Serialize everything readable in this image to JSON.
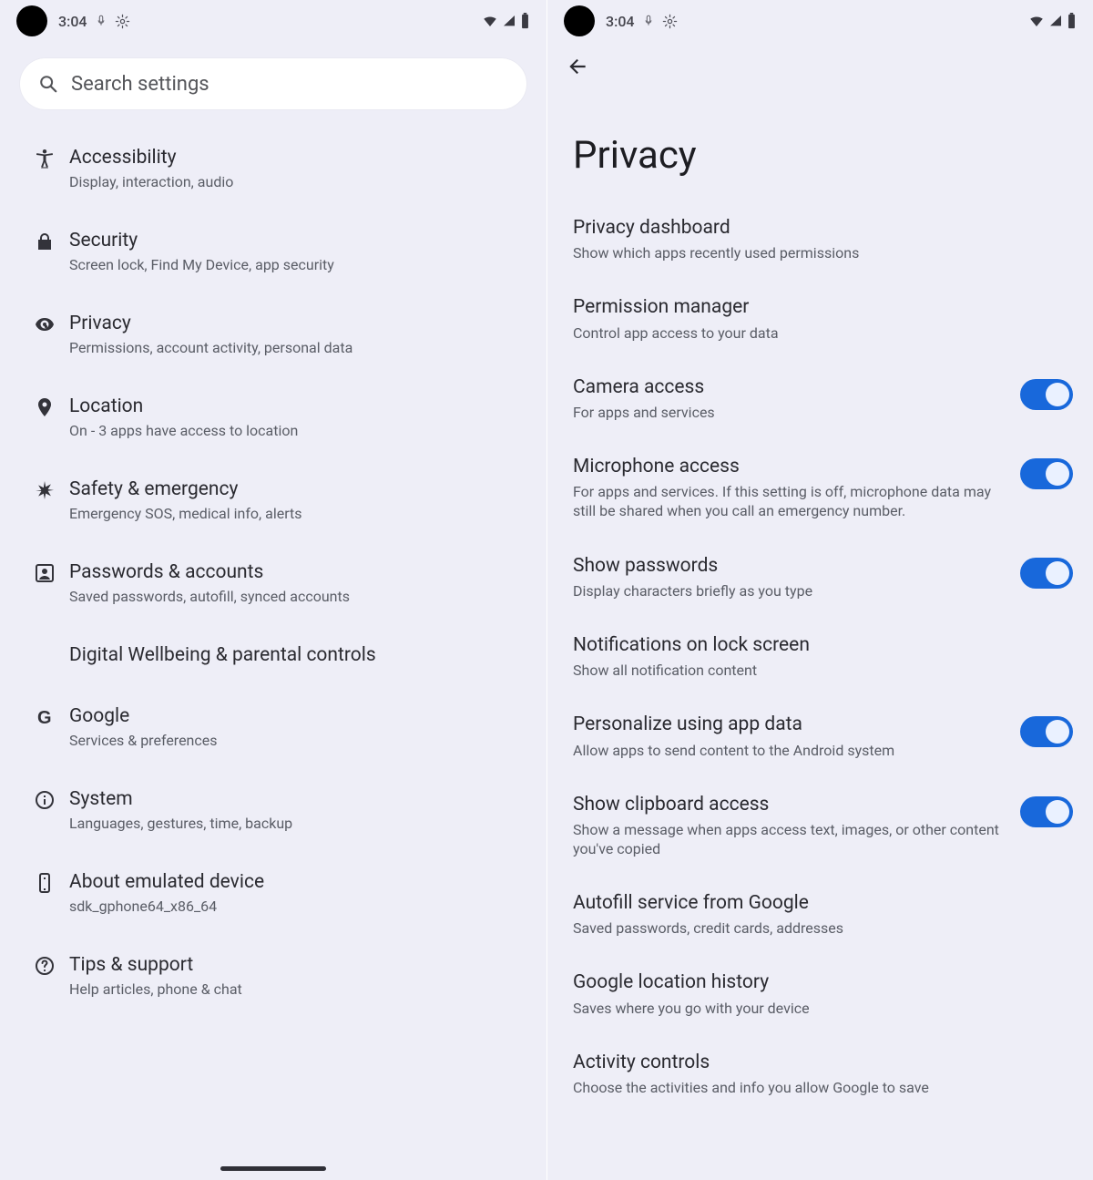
{
  "status": {
    "time": "3:04"
  },
  "left_screen": {
    "search_placeholder": "Search settings",
    "items": [
      {
        "icon": "accessibility",
        "title": "Accessibility",
        "sub": "Display, interaction, audio"
      },
      {
        "icon": "lock",
        "title": "Security",
        "sub": "Screen lock, Find My Device, app security"
      },
      {
        "icon": "privacy",
        "title": "Privacy",
        "sub": "Permissions, account activity, personal data"
      },
      {
        "icon": "location",
        "title": "Location",
        "sub": "On - 3 apps have access to location"
      },
      {
        "icon": "asterisk",
        "title": "Safety & emergency",
        "sub": "Emergency SOS, medical info, alerts"
      },
      {
        "icon": "account",
        "title": "Passwords & accounts",
        "sub": "Saved passwords, autofill, synced accounts"
      },
      {
        "icon": "",
        "title": "Digital Wellbeing & parental controls",
        "sub": ""
      },
      {
        "icon": "google",
        "title": "Google",
        "sub": "Services & preferences"
      },
      {
        "icon": "info",
        "title": "System",
        "sub": "Languages, gestures, time, backup"
      },
      {
        "icon": "device",
        "title": "About emulated device",
        "sub": "sdk_gphone64_x86_64"
      },
      {
        "icon": "help",
        "title": "Tips & support",
        "sub": "Help articles, phone & chat"
      }
    ]
  },
  "right_screen": {
    "page_title": "Privacy",
    "prefs": [
      {
        "title": "Privacy dashboard",
        "sub": "Show which apps recently used permissions",
        "toggle": null
      },
      {
        "title": "Permission manager",
        "sub": "Control app access to your data",
        "toggle": null
      },
      {
        "title": "Camera access",
        "sub": "For apps and services",
        "toggle": true
      },
      {
        "title": "Microphone access",
        "sub": "For apps and services. If this setting is off, microphone data may still be shared when you call an emergency number.",
        "toggle": true
      },
      {
        "title": "Show passwords",
        "sub": "Display characters briefly as you type",
        "toggle": true
      },
      {
        "title": "Notifications on lock screen",
        "sub": "Show all notification content",
        "toggle": null
      },
      {
        "title": "Personalize using app data",
        "sub": "Allow apps to send content to the Android system",
        "toggle": true
      },
      {
        "title": "Show clipboard access",
        "sub": "Show a message when apps access text, images, or other content you've copied",
        "toggle": true
      },
      {
        "title": "Autofill service from Google",
        "sub": "Saved passwords, credit cards, addresses",
        "toggle": null
      },
      {
        "title": "Google location history",
        "sub": "Saves where you go with your device",
        "toggle": null
      },
      {
        "title": "Activity controls",
        "sub": "Choose the activities and info you allow Google to save",
        "toggle": null
      }
    ]
  }
}
